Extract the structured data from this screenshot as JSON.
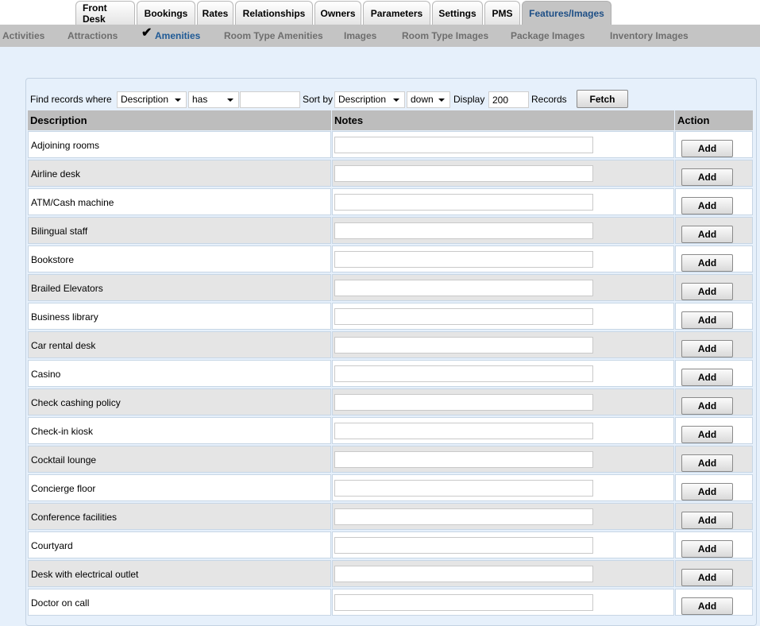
{
  "tabs": [
    {
      "label": "Front Desk",
      "name": "tab-front-desk",
      "left": 0,
      "width": 75
    },
    {
      "label": "Bookings",
      "name": "tab-bookings",
      "left": 0,
      "width": 74
    },
    {
      "label": "Rates",
      "name": "tab-rates",
      "left": 0,
      "width": 46
    },
    {
      "label": "Relationships",
      "name": "tab-relationships",
      "left": 0,
      "width": 98
    },
    {
      "label": "Owners",
      "name": "tab-owners",
      "left": 0,
      "width": 59
    },
    {
      "label": "Parameters",
      "name": "tab-parameters",
      "left": 0,
      "width": 85
    },
    {
      "label": "Settings",
      "name": "tab-settings",
      "left": 0,
      "width": 64
    },
    {
      "label": "PMS",
      "name": "tab-pms",
      "left": 0,
      "width": 45
    },
    {
      "label": "Features/Images",
      "name": "tab-features-images",
      "left": 0,
      "width": 113
    }
  ],
  "subnav": [
    "Activities",
    "Attractions",
    "Amenities",
    "Room Type Amenities",
    "Images",
    "Room Type Images",
    "Package Images",
    "Inventory Images"
  ],
  "filter": {
    "find_label": "Find records where",
    "field_value": "Description",
    "operator_value": "has",
    "search_value": "",
    "sort_label": "Sort by",
    "sort_value": "Description",
    "direction_value": "down",
    "display_label": "Display",
    "display_value": "200",
    "records_label": "Records",
    "fetch_label": "Fetch"
  },
  "table": {
    "headers": {
      "description": "Description",
      "notes": "Notes",
      "action": "Action"
    },
    "add_label": "Add",
    "rows": [
      "Adjoining rooms",
      "Airline desk",
      "ATM/Cash machine",
      "Bilingual staff",
      "Bookstore",
      "Brailed Elevators",
      "Business library",
      "Car rental desk",
      "Casino",
      "Check cashing policy",
      "Check-in kiosk",
      "Cocktail lounge",
      "Concierge floor",
      "Conference facilities",
      "Courtyard",
      "Desk with electrical outlet",
      "Doctor on call"
    ]
  }
}
